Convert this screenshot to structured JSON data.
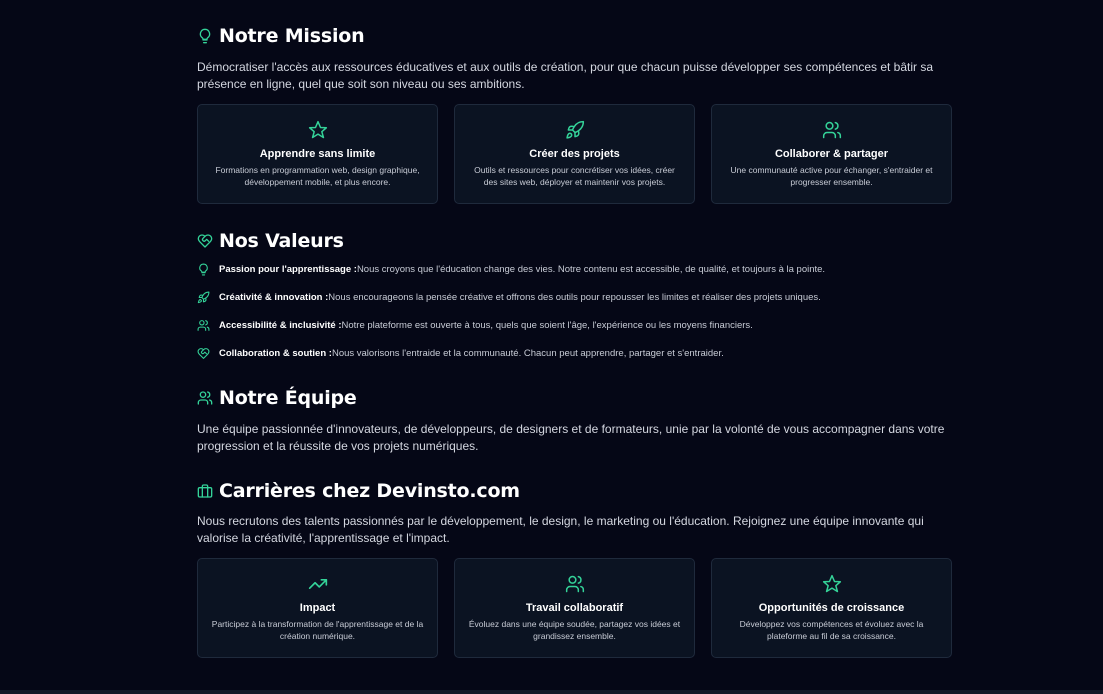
{
  "mission": {
    "title": "Notre Mission",
    "text": "Démocratiser l'accès aux ressources éducatives et aux outils de création, pour que chacun puisse développer ses compétences et bâtir sa présence en ligne, quel que soit son niveau ou ses ambitions.",
    "cards": [
      {
        "icon": "star-icon",
        "title": "Apprendre sans limite",
        "text": "Formations en programmation web, design graphique, développement mobile, et plus encore."
      },
      {
        "icon": "rocket-icon",
        "title": "Créer des projets",
        "text": "Outils et ressources pour concrétiser vos idées, créer des sites web, déployer et maintenir vos projets."
      },
      {
        "icon": "users-icon",
        "title": "Collaborer & partager",
        "text": "Une communauté active pour échanger, s'entraider et progresser ensemble."
      }
    ]
  },
  "values": {
    "title": "Nos Valeurs",
    "items": [
      {
        "icon": "lightbulb-icon",
        "label": "Passion pour l'apprentissage :",
        "text": "Nous croyons que l'éducation change des vies. Notre contenu est accessible, de qualité, et toujours à la pointe."
      },
      {
        "icon": "rocket-icon",
        "label": "Créativité & innovation :",
        "text": "Nous encourageons la pensée créative et offrons des outils pour repousser les limites et réaliser des projets uniques."
      },
      {
        "icon": "users-icon",
        "label": "Accessibilité & inclusivité :",
        "text": "Notre plateforme est ouverte à tous, quels que soient l'âge, l'expérience ou les moyens financiers."
      },
      {
        "icon": "heart-handshake-icon",
        "label": "Collaboration & soutien :",
        "text": "Nous valorisons l'entraide et la communauté. Chacun peut apprendre, partager et s'entraider."
      }
    ]
  },
  "team": {
    "title": "Notre Équipe",
    "text": "Une équipe passionnée d'innovateurs, de développeurs, de designers et de formateurs, unie par la volonté de vous accompagner dans votre progression et la réussite de vos projets numériques."
  },
  "careers": {
    "title": "Carrières chez Devinsto.com",
    "text": "Nous recrutons des talents passionnés par le développement, le design, le marketing ou l'éducation. Rejoignez une équipe innovante qui valorise la créativité, l'apprentissage et l'impact.",
    "cards": [
      {
        "icon": "trending-up-icon",
        "title": "Impact",
        "text": "Participez à la transformation de l'apprentissage et de la création numérique."
      },
      {
        "icon": "users-icon",
        "title": "Travail collaboratif",
        "text": "Évoluez dans une équipe soudée, partagez vos idées et grandissez ensemble."
      },
      {
        "icon": "star-icon",
        "title": "Opportunités de croissance",
        "text": "Développez vos compétences et évoluez avec la plateforme au fil de sa croissance."
      }
    ]
  },
  "colors": {
    "accent": "#34d399",
    "background": "#050716",
    "card_bg": "#0b1322",
    "card_border": "#1f2a3c"
  }
}
